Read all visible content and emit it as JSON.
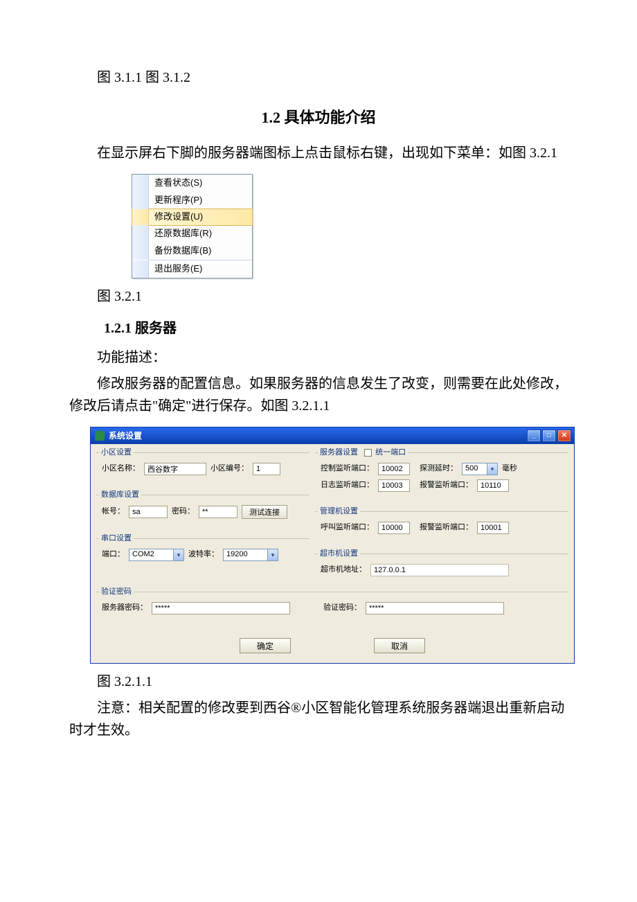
{
  "text": {
    "line1": "图 3.1.1 图 3.1.2",
    "heading12": "1.2 具体功能介绍",
    "intro12": "在显示屏右下脚的服务器端图标上点击鼠标右键，出现如下菜单：如图 3.2.1",
    "caption321": "图 3.2.1",
    "heading121": "1.2.1 服务器",
    "funcDesc": "功能描述：",
    "body121a": "修改服务器的配置信息。如果服务器的信息发生了改变，则需要在此处修改，修改后请点击\"确定\"进行保存。如图 3.2.1.1",
    "caption3211": "图 3.2.1.1",
    "note": "注意：相关配置的修改要到西谷®小区智能化管理系统服务器端退出重新启动时才生效。"
  },
  "ctxMenu": {
    "items": [
      {
        "label": "查看状态(S)"
      },
      {
        "label": "更新程序(P)"
      },
      {
        "label": "修改设置(U)",
        "selected": true
      },
      {
        "label": "还原数据库(R)"
      },
      {
        "label": "备份数据库(B)"
      },
      {
        "label": "退出服务(E)"
      }
    ]
  },
  "dialog": {
    "title": "系统设置",
    "groups": {
      "community": {
        "legend": "小区设置",
        "nameLabel": "小区名称：",
        "nameValue": "西谷数字",
        "codeLabel": "小区编号：",
        "codeValue": "1"
      },
      "database": {
        "legend": "数据库设置",
        "userLabel": "帐号：",
        "userValue": "sa",
        "pwdLabel": "密码：",
        "pwdValue": "**",
        "testBtn": "测试连接"
      },
      "serial": {
        "legend": "串口设置",
        "portLabel": "端口：",
        "portValue": "COM2",
        "baudLabel": "波特率：",
        "baudValue": "19200"
      },
      "server": {
        "legend": "服务器设置",
        "unifiedPort": "统一端口",
        "ctrlPortLabel": "控制监听端口：",
        "ctrlPortValue": "10002",
        "probeDelayLabel": "探测延时：",
        "probeDelayValue": "500",
        "probeDelayUnit": "毫秒",
        "logPortLabel": "日志监听端口：",
        "logPortValue": "10003",
        "alarmPortLabel": "报警监听端口：",
        "alarmPortValue": "10110"
      },
      "manager": {
        "legend": "管理机设置",
        "callPortLabel": "呼叫监听端口：",
        "callPortValue": "10000",
        "alarmPortLabel": "报警监听端口：",
        "alarmPortValue": "10001"
      },
      "market": {
        "legend": "超市机设置",
        "addrLabel": "超市机地址：",
        "addrValue": "127.0.0.1"
      },
      "verify": {
        "legend": "验证密码",
        "srvPwdLabel": "服务器密码：",
        "srvPwdValue": "*****",
        "vPwdLabel": "验证密码：",
        "vPwdValue": "*****"
      }
    },
    "okBtn": "确定",
    "cancelBtn": "取消"
  }
}
